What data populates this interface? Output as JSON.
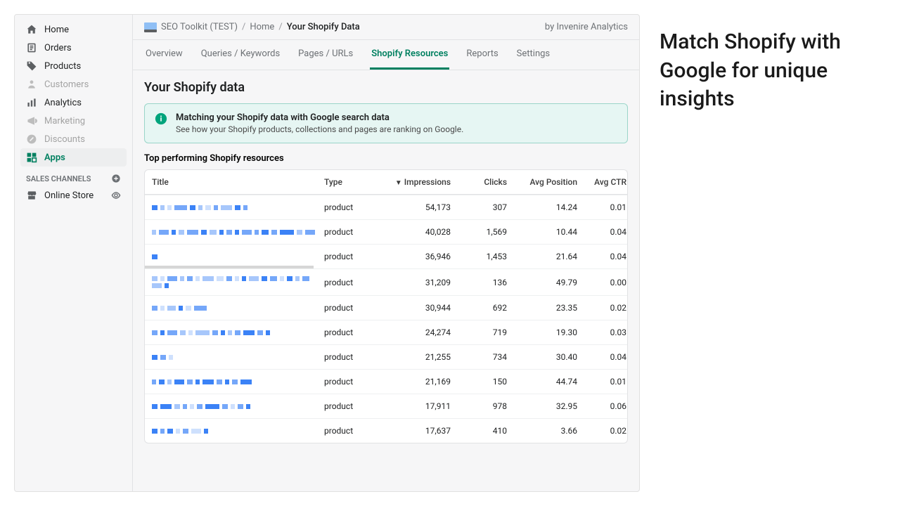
{
  "sidebar": {
    "items": [
      {
        "label": "Home",
        "icon": "home"
      },
      {
        "label": "Orders",
        "icon": "orders"
      },
      {
        "label": "Products",
        "icon": "products"
      },
      {
        "label": "Customers",
        "icon": "customers",
        "muted": true
      },
      {
        "label": "Analytics",
        "icon": "analytics"
      },
      {
        "label": "Marketing",
        "icon": "marketing",
        "muted": true
      },
      {
        "label": "Discounts",
        "icon": "discounts",
        "muted": true
      },
      {
        "label": "Apps",
        "icon": "apps",
        "active": true
      }
    ],
    "section_label": "SALES CHANNELS",
    "channels": [
      {
        "label": "Online Store",
        "icon": "store"
      }
    ]
  },
  "topbar": {
    "app_name": "SEO Toolkit (TEST)",
    "crumb_home": "Home",
    "crumb_current": "Your Shopify Data",
    "attribution": "by Invenire Analytics"
  },
  "tabs": [
    {
      "label": "Overview"
    },
    {
      "label": "Queries / Keywords"
    },
    {
      "label": "Pages / URLs"
    },
    {
      "label": "Shopify Resources",
      "active": true
    },
    {
      "label": "Reports"
    },
    {
      "label": "Settings"
    }
  ],
  "page_title": "Your Shopify data",
  "info": {
    "title": "Matching your Shopify data with Google search data",
    "desc": "See how your Shopify products, collections and pages are ranking on Google."
  },
  "section_title": "Top performing Shopify resources",
  "columns": {
    "title": "Title",
    "type": "Type",
    "impressions": "Impressions",
    "clicks": "Clicks",
    "avg_position": "Avg Position",
    "avg_ctr": "Avg CTR"
  },
  "rows": [
    {
      "type": "product",
      "impressions": "54,173",
      "clicks": "307",
      "avg_position": "14.24",
      "avg_ctr": "0.01"
    },
    {
      "type": "product",
      "impressions": "40,028",
      "clicks": "1,569",
      "avg_position": "10.44",
      "avg_ctr": "0.04"
    },
    {
      "type": "product",
      "impressions": "36,946",
      "clicks": "1,453",
      "avg_position": "21.64",
      "avg_ctr": "0.04",
      "selected": true
    },
    {
      "type": "product",
      "impressions": "31,209",
      "clicks": "136",
      "avg_position": "49.79",
      "avg_ctr": "0.00"
    },
    {
      "type": "product",
      "impressions": "30,944",
      "clicks": "692",
      "avg_position": "23.35",
      "avg_ctr": "0.02"
    },
    {
      "type": "product",
      "impressions": "24,274",
      "clicks": "719",
      "avg_position": "19.30",
      "avg_ctr": "0.03"
    },
    {
      "type": "product",
      "impressions": "21,255",
      "clicks": "734",
      "avg_position": "30.40",
      "avg_ctr": "0.04"
    },
    {
      "type": "product",
      "impressions": "21,169",
      "clicks": "150",
      "avg_position": "44.74",
      "avg_ctr": "0.01"
    },
    {
      "type": "product",
      "impressions": "17,911",
      "clicks": "978",
      "avg_position": "32.95",
      "avg_ctr": "0.06"
    },
    {
      "type": "product",
      "impressions": "17,637",
      "clicks": "410",
      "avg_position": "3.66",
      "avg_ctr": "0.02"
    }
  ],
  "marketing_headline": "Match Shopify with Google for unique insights"
}
